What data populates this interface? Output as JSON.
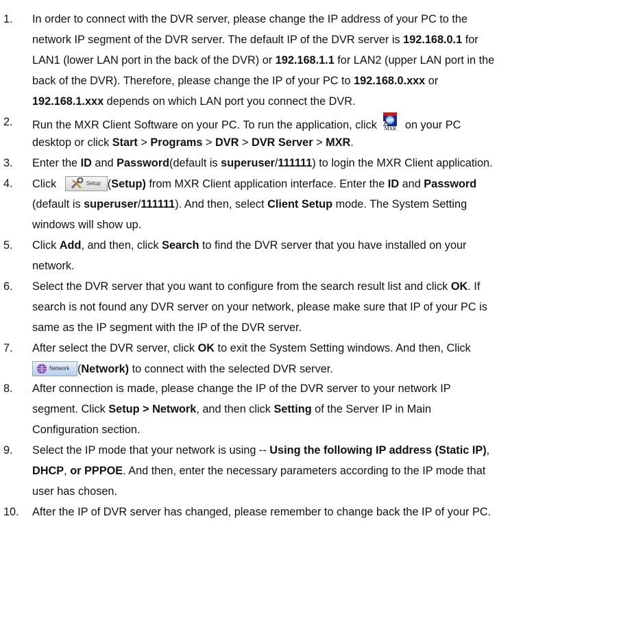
{
  "steps": [
    {
      "n": "1.",
      "lines": [
        [
          {
            "t": "In order to connect with the DVR server, please change the IP address of your PC to the"
          }
        ],
        [
          {
            "t": "network IP segment of the DVR server. The default IP of the DVR server is "
          },
          {
            "t": "192.168.0.1",
            "b": 1
          },
          {
            "t": " for"
          }
        ],
        [
          {
            "t": "LAN1 (lower LAN port in the back of the DVR) or "
          },
          {
            "t": "192.168.1.1",
            "b": 1
          },
          {
            "t": " for LAN2 (upper LAN port in the"
          }
        ],
        [
          {
            "t": "back of the DVR). Therefore, please change the IP of your PC to "
          },
          {
            "t": "192.168.0.xxx",
            "b": 1
          },
          {
            "t": " or"
          }
        ],
        [
          {
            "t": "192.168.1.xxx",
            "b": 1
          },
          {
            "t": " depends on which LAN port you connect the DVR."
          }
        ]
      ]
    },
    {
      "n": "2.",
      "lines": [
        [
          {
            "t": "Run the MXR Client Software on your PC. To run the application, click "
          },
          {
            "icon": "mxr"
          },
          {
            "t": " on your PC"
          }
        ],
        [
          {
            "t": "desktop or click "
          },
          {
            "t": "Start",
            "b": 1
          },
          {
            "t": " > "
          },
          {
            "t": "Programs",
            "b": 1
          },
          {
            "t": " > "
          },
          {
            "t": "DVR",
            "b": 1
          },
          {
            "t": " > "
          },
          {
            "t": "DVR Server",
            "b": 1
          },
          {
            "t": " > "
          },
          {
            "t": "MXR",
            "b": 1
          },
          {
            "t": "."
          }
        ]
      ]
    },
    {
      "n": "3.",
      "lines": [
        [
          {
            "t": "Enter the "
          },
          {
            "t": "ID",
            "b": 1
          },
          {
            "t": " and "
          },
          {
            "t": "Password",
            "b": 1
          },
          {
            "t": "(default is "
          },
          {
            "t": "superuser",
            "b": 1
          },
          {
            "t": "/"
          },
          {
            "t": "111111",
            "b": 1
          },
          {
            "t": ") to login the MXR Client application."
          }
        ]
      ]
    },
    {
      "n": "4.",
      "lines": [
        [
          {
            "t": "Click "
          },
          {
            "icon": "setup"
          },
          {
            "t": "("
          },
          {
            "t": "Setup)",
            "b": 1
          },
          {
            "t": " from MXR Client application interface. Enter the "
          },
          {
            "t": "ID",
            "b": 1
          },
          {
            "t": " and "
          },
          {
            "t": "Password",
            "b": 1
          }
        ],
        [
          {
            "t": "(default is "
          },
          {
            "t": "superuser",
            "b": 1
          },
          {
            "t": "/"
          },
          {
            "t": "111111",
            "b": 1
          },
          {
            "t": "). And then, select "
          },
          {
            "t": "Client Setup",
            "b": 1
          },
          {
            "t": " mode. The System Setting"
          }
        ],
        [
          {
            "t": "windows will show up."
          }
        ]
      ]
    },
    {
      "n": "5.",
      "lines": [
        [
          {
            "t": "Click "
          },
          {
            "t": "Add",
            "b": 1
          },
          {
            "t": ", and then, click "
          },
          {
            "t": "Search",
            "b": 1
          },
          {
            "t": " to find the DVR server that you have installed on your"
          }
        ],
        [
          {
            "t": "network."
          }
        ]
      ]
    },
    {
      "n": "6.",
      "lines": [
        [
          {
            "t": "Select the DVR server that you want to configure from the search result list and click "
          },
          {
            "t": "OK",
            "b": 1
          },
          {
            "t": ". If"
          }
        ],
        [
          {
            "t": "search is not found any DVR server on your network, please make sure that IP of your PC is"
          }
        ],
        [
          {
            "t": "same as the IP segment with the IP of the DVR server."
          }
        ]
      ]
    },
    {
      "n": "7.",
      "lines": [
        [
          {
            "t": "After select the DVR server, click "
          },
          {
            "t": "OK",
            "b": 1
          },
          {
            "t": " to exit the System Setting windows. And then, Click"
          }
        ],
        [
          {
            "icon": "network"
          },
          {
            "t": "("
          },
          {
            "t": "Network)",
            "b": 1
          },
          {
            "t": " to connect with the selected DVR server."
          }
        ]
      ]
    },
    {
      "n": "8.",
      "lines": [
        [
          {
            "t": "After connection is made, please change the IP of the DVR server to your network IP"
          }
        ],
        [
          {
            "t": "segment. Click "
          },
          {
            "t": "Setup > Network",
            "b": 1
          },
          {
            "t": ", and then click "
          },
          {
            "t": "Setting",
            "b": 1
          },
          {
            "t": " of the Server IP in Main"
          }
        ],
        [
          {
            "t": "Configuration section."
          }
        ]
      ]
    },
    {
      "n": "9.",
      "lines": [
        [
          {
            "t": "Select the IP mode that your network is using -- "
          },
          {
            "t": "Using the following IP address (Static IP)",
            "b": 1
          },
          {
            "t": ","
          }
        ],
        [
          {
            "t": "DHCP",
            "b": 1
          },
          {
            "t": ", "
          },
          {
            "t": "or PPPOE",
            "b": 1
          },
          {
            "t": ". And then, enter the necessary parameters according to the IP mode that"
          }
        ],
        [
          {
            "t": "user has chosen."
          }
        ]
      ]
    },
    {
      "n": "10.",
      "lines": [
        [
          {
            "t": "After the IP of DVR server has changed, please remember to change back the IP of your PC."
          }
        ]
      ]
    }
  ],
  "icons": {
    "mxr": {
      "caption": "MXR"
    },
    "setup": {
      "caption": "Setup"
    },
    "network": {
      "caption": "Network"
    }
  }
}
